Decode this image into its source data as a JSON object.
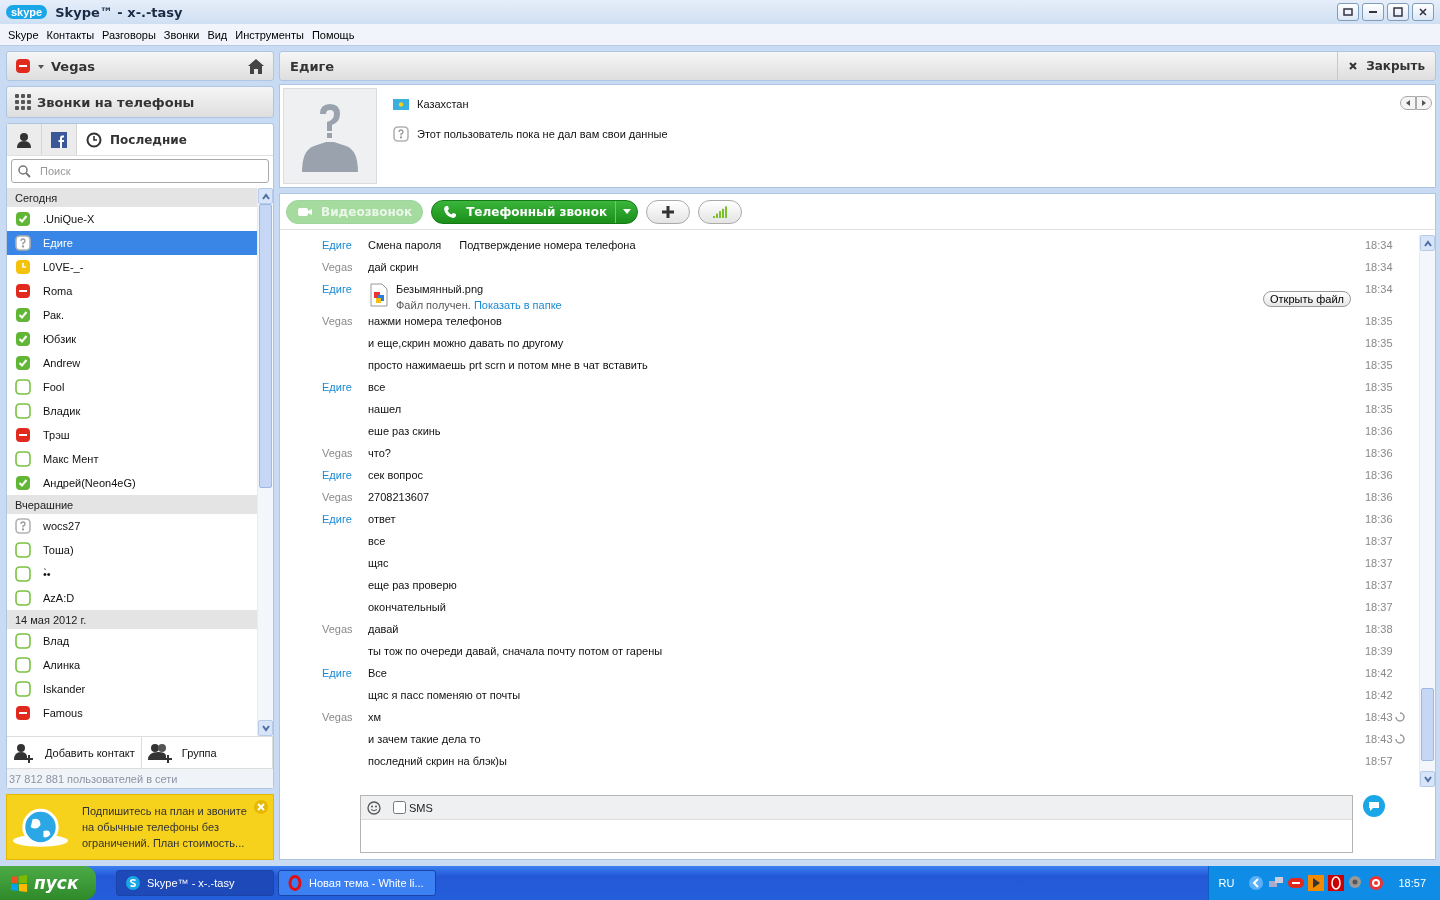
{
  "window": {
    "title": "Skype™ - x-.-tasy"
  },
  "menu": [
    "Skype",
    "Контакты",
    "Разговоры",
    "Звонки",
    "Вид",
    "Инструменты",
    "Помощь"
  ],
  "user": {
    "name": "Vegas",
    "kind": "dnd"
  },
  "phone_calls": "Звонки на телефоны",
  "contact_tabs": [
    {
      "kind": "contacts",
      "selected": false
    },
    {
      "kind": "facebook",
      "selected": false
    },
    {
      "kind": "recent",
      "label": "Последние",
      "selected": true
    }
  ],
  "search": {
    "placeholder": "Поиск"
  },
  "contact_groups": [
    {
      "title": "Сегодня",
      "contacts": [
        {
          "name": ".UniQue-X",
          "kind": "online",
          "selected": false
        },
        {
          "name": "Едиге",
          "kind": "unknown",
          "selected": true
        },
        {
          "name": "L0VE-_-",
          "kind": "away",
          "selected": false
        },
        {
          "name": "Roma",
          "kind": "dnd",
          "selected": false
        },
        {
          "name": "Рак.",
          "kind": "online",
          "selected": false
        },
        {
          "name": "Юбзик",
          "kind": "online",
          "selected": false
        },
        {
          "name": "Andrew",
          "kind": "online",
          "selected": false
        },
        {
          "name": "Fool",
          "kind": "offline",
          "selected": false
        },
        {
          "name": "Владик",
          "kind": "offline",
          "selected": false
        },
        {
          "name": "Трэш",
          "kind": "dnd",
          "selected": false
        },
        {
          "name": "Макс Мент",
          "kind": "offline",
          "selected": false
        },
        {
          "name": "Андрей(Neon4eG)",
          "kind": "online",
          "selected": false
        }
      ]
    },
    {
      "title": "Вчерашние",
      "contacts": [
        {
          "name": "wocs27",
          "kind": "unknown",
          "selected": false
        },
        {
          "name": "Тоша)",
          "kind": "offline",
          "selected": false
        },
        {
          "name": "•̀•",
          "kind": "offline",
          "selected": false
        },
        {
          "name": "AzA:D",
          "kind": "offline",
          "selected": false
        }
      ]
    },
    {
      "title": "14 мая 2012 г.",
      "contacts": [
        {
          "name": "Влад",
          "kind": "offline",
          "selected": false
        },
        {
          "name": "Алинка",
          "kind": "offline",
          "selected": false
        },
        {
          "name": "Iskander",
          "kind": "offline",
          "selected": false
        },
        {
          "name": "Famous",
          "kind": "dnd",
          "selected": false
        }
      ]
    }
  ],
  "contact_actions": [
    {
      "kind": "add-contact",
      "label": "Добавить контакт"
    },
    {
      "kind": "group",
      "label": "Группа"
    }
  ],
  "online_count": "37 812 881 пользователей в сети",
  "promo": {
    "text": "Подпишитесь на план и звоните на обычные телефоны без ограничений. План стоимость..."
  },
  "conversation": {
    "title": "Едиге",
    "close_label": "Закрыть",
    "country": "Казахстан",
    "notice": "Этот пользователь пока не дал вам свои данные"
  },
  "call_buttons": [
    {
      "kind": "video",
      "label": "Видеозвонок",
      "disabled": true
    },
    {
      "kind": "call",
      "label": "Телефонный звонок",
      "disabled": false
    },
    {
      "kind": "add",
      "disabled": false
    },
    {
      "kind": "quality",
      "disabled": false
    }
  ],
  "messages": [
    {
      "kind": "text",
      "sender": "Едиге",
      "color": "#1a8ad4",
      "texts": [
        "Смена пароля",
        "Подтверждение номера телефона"
      ],
      "time": "18:34",
      "pending": false
    },
    {
      "kind": "text",
      "sender": "Vegas",
      "color": "#8a8a8a",
      "texts": [
        "дай скрин"
      ],
      "time": "18:34",
      "pending": false
    },
    {
      "kind": "file",
      "sender": "Едиге",
      "color": "#1a8ad4",
      "file": "Безымянный.png",
      "status": "Файл получен.",
      "link": "Показать в папке",
      "action": "Открыть файл",
      "time": "18:34",
      "pending": false
    },
    {
      "kind": "text",
      "sender": "Vegas",
      "color": "#8a8a8a",
      "texts": [
        "нажми номера телефонов"
      ],
      "time": "18:35",
      "pending": false
    },
    {
      "kind": "text",
      "texts": [
        "и еще,скрин можно давать по другому"
      ],
      "time": "18:35",
      "pending": false
    },
    {
      "kind": "text",
      "texts": [
        "просто нажимаешь prt scrn и потом мне в чат вставить"
      ],
      "time": "18:35",
      "pending": false
    },
    {
      "kind": "text",
      "sender": "Едиге",
      "color": "#1a8ad4",
      "texts": [
        "все"
      ],
      "time": "18:35",
      "pending": false
    },
    {
      "kind": "text",
      "texts": [
        "нашел"
      ],
      "time": "18:35",
      "pending": false
    },
    {
      "kind": "text",
      "texts": [
        "еше раз скинь"
      ],
      "time": "18:36",
      "pending": false
    },
    {
      "kind": "text",
      "sender": "Vegas",
      "color": "#8a8a8a",
      "texts": [
        "что?"
      ],
      "time": "18:36",
      "pending": false
    },
    {
      "kind": "text",
      "sender": "Едиге",
      "color": "#1a8ad4",
      "texts": [
        "сек вопрос"
      ],
      "time": "18:36",
      "pending": false
    },
    {
      "kind": "text",
      "sender": "Vegas",
      "color": "#8a8a8a",
      "texts": [
        "2708213607"
      ],
      "time": "18:36",
      "pending": false
    },
    {
      "kind": "text",
      "sender": "Едиге",
      "color": "#1a8ad4",
      "texts": [
        "ответ"
      ],
      "time": "18:36",
      "pending": false
    },
    {
      "kind": "text",
      "texts": [
        "все"
      ],
      "time": "18:37",
      "pending": false
    },
    {
      "kind": "text",
      "texts": [
        "щяс"
      ],
      "time": "18:37",
      "pending": false
    },
    {
      "kind": "text",
      "texts": [
        "еще раз проверю"
      ],
      "time": "18:37",
      "pending": false
    },
    {
      "kind": "text",
      "texts": [
        "окончательный"
      ],
      "time": "18:37",
      "pending": false
    },
    {
      "kind": "text",
      "sender": "Vegas",
      "color": "#8a8a8a",
      "texts": [
        "давай"
      ],
      "time": "18:38",
      "pending": false
    },
    {
      "kind": "text",
      "texts": [
        "ты тож по очереди давай, сначала почту потом от гарены"
      ],
      "time": "18:39",
      "pending": false
    },
    {
      "kind": "text",
      "sender": "Едиге",
      "color": "#1a8ad4",
      "texts": [
        "Все"
      ],
      "time": "18:42",
      "pending": false
    },
    {
      "kind": "text",
      "texts": [
        "щяс я пасс поменяю от почты"
      ],
      "time": "18:42",
      "pending": false
    },
    {
      "kind": "text",
      "sender": "Vegas",
      "color": "#8a8a8a",
      "texts": [
        "хм"
      ],
      "time": "18:43",
      "pending": true
    },
    {
      "kind": "text",
      "texts": [
        "и зачем такие дела то"
      ],
      "time": "18:43",
      "pending": true
    },
    {
      "kind": "text",
      "texts": [
        "последний скрин на блэк)ы"
      ],
      "time": "18:57",
      "pending": false
    }
  ],
  "composer": {
    "sms_label": "SMS",
    "sms_checked": false
  },
  "taskbar": {
    "start": "пуск",
    "tasks": [
      {
        "kind": "skype",
        "label": "Skype™ - x-.-tasy",
        "selected": true
      },
      {
        "kind": "opera",
        "label": "Новая тема - White li...",
        "selected": false
      }
    ],
    "language": "RU",
    "clock": "18:57"
  }
}
